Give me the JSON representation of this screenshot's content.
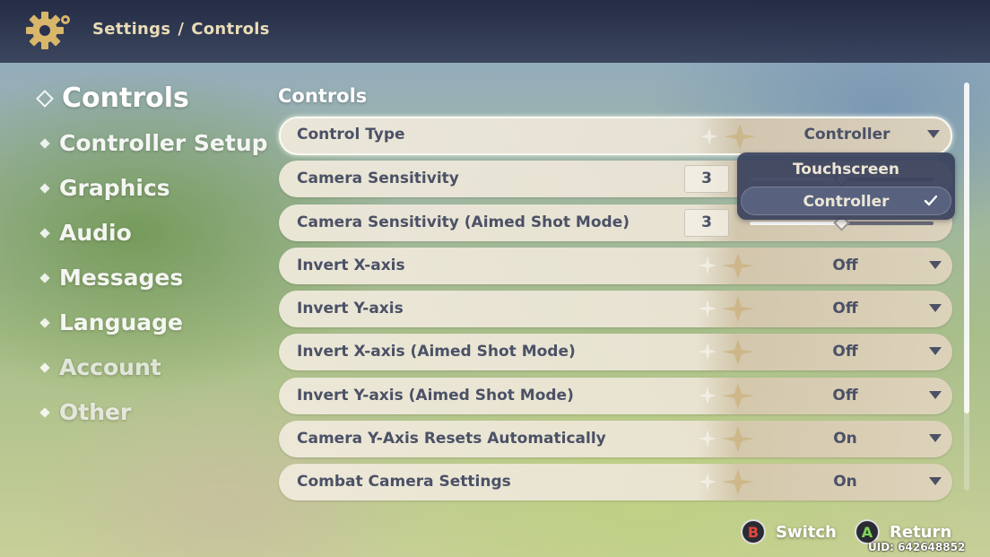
{
  "header": {
    "icon": "gear-icon",
    "breadcrumb_root": "Settings",
    "breadcrumb_sep": "/",
    "breadcrumb_current": "Controls"
  },
  "nav": {
    "items": [
      {
        "label": "Controls",
        "active": true
      },
      {
        "label": "Controller Setup"
      },
      {
        "label": "Graphics"
      },
      {
        "label": "Audio"
      },
      {
        "label": "Messages"
      },
      {
        "label": "Language"
      },
      {
        "label": "Account"
      },
      {
        "label": "Other"
      }
    ]
  },
  "section": {
    "title": "Controls"
  },
  "settings": [
    {
      "label": "Control Type",
      "value": "Controller",
      "kind": "dropdown",
      "selected": true
    },
    {
      "label": "Camera Sensitivity",
      "value": "3",
      "kind": "slider",
      "level": 0.5
    },
    {
      "label": "Camera Sensitivity (Aimed Shot Mode)",
      "value": "3",
      "kind": "slider",
      "level": 0.5
    },
    {
      "label": "Invert X-axis",
      "value": "Off",
      "kind": "dropdown"
    },
    {
      "label": "Invert Y-axis",
      "value": "Off",
      "kind": "dropdown"
    },
    {
      "label": "Invert X-axis (Aimed Shot Mode)",
      "value": "Off",
      "kind": "dropdown"
    },
    {
      "label": "Invert Y-axis (Aimed Shot Mode)",
      "value": "Off",
      "kind": "dropdown"
    },
    {
      "label": "Camera Y-Axis Resets Automatically",
      "value": "On",
      "kind": "dropdown"
    },
    {
      "label": "Combat Camera Settings",
      "value": "On",
      "kind": "dropdown"
    }
  ],
  "dropdown_popup": {
    "options": [
      "Touchscreen",
      "Controller"
    ],
    "selected": "Controller"
  },
  "footer": {
    "switch_button": "B",
    "switch_label": "Switch",
    "return_button": "A",
    "return_label": "Return",
    "uid": "UID: 642648852"
  },
  "colors": {
    "row_text": "#4b5166",
    "popup_bg": "#3a425c",
    "header_text": "#e9dcb7"
  },
  "scroll": {
    "thumb_fraction": 0.81
  }
}
